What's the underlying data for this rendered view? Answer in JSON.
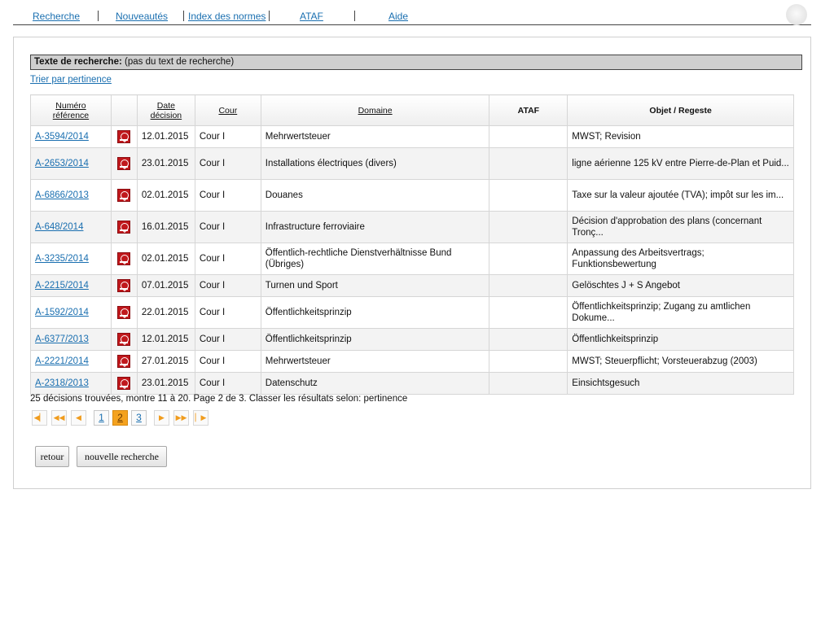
{
  "nav": {
    "items": [
      "Recherche",
      "Nouveautés",
      "Index des normes",
      "ATAF",
      "Aide"
    ]
  },
  "search": {
    "label": "Texte de recherche:",
    "value": "(pas du text de recherche)",
    "sort_link": "Trier par pertinence"
  },
  "table": {
    "headers": {
      "ref_line1": "Numéro",
      "ref_line2": "référence",
      "date_line1": "Date",
      "date_line2": "décision",
      "court": "Cour",
      "domain": "Domaine",
      "ataf": "ATAF",
      "subject": "Objet / Regeste"
    },
    "rows": [
      {
        "ref": "A-3594/2014",
        "date": "12.01.2015",
        "court": "Cour I",
        "domain": "Mehrwertsteuer",
        "ataf": "",
        "subject": "MWST; Revision"
      },
      {
        "ref": "A-2653/2014",
        "date": "23.01.2015",
        "court": "Cour I",
        "domain": "Installations électriques (divers)",
        "ataf": "",
        "subject": "ligne aérienne 125 kV entre Pierre-de-Plan et Puid..."
      },
      {
        "ref": "A-6866/2013",
        "date": "02.01.2015",
        "court": "Cour I",
        "domain": "Douanes",
        "ataf": "",
        "subject": "Taxe sur la valeur ajoutée (TVA); impôt sur les im..."
      },
      {
        "ref": "A-648/2014",
        "date": "16.01.2015",
        "court": "Cour I",
        "domain": "Infrastructure ferroviaire",
        "ataf": "",
        "subject": "Décision d'approbation des plans (concernant Tronç..."
      },
      {
        "ref": "A-3235/2014",
        "date": "02.01.2015",
        "court": "Cour I",
        "domain": "Öffentlich-rechtliche Dienstverhältnisse Bund (Übriges)",
        "ataf": "",
        "subject": "Anpassung des Arbeitsvertrags; Funktionsbewertung"
      },
      {
        "ref": "A-2215/2014",
        "date": "07.01.2015",
        "court": "Cour I",
        "domain": "Turnen und Sport",
        "ataf": "",
        "subject": "Gelöschtes J + S Angebot"
      },
      {
        "ref": "A-1592/2014",
        "date": "22.01.2015",
        "court": "Cour I",
        "domain": "Öffentlichkeitsprinzip",
        "ataf": "",
        "subject": "Öffentlichkeitsprinzip; Zugang zu amtlichen Dokume..."
      },
      {
        "ref": "A-6377/2013",
        "date": "12.01.2015",
        "court": "Cour I",
        "domain": "Öffentlichkeitsprinzip",
        "ataf": "",
        "subject": "Öffentlichkeitsprinzip"
      },
      {
        "ref": "A-2221/2014",
        "date": "27.01.2015",
        "court": "Cour I",
        "domain": "Mehrwertsteuer",
        "ataf": "",
        "subject": "MWST; Steuerpflicht; Vorsteuerabzug (2003)"
      },
      {
        "ref": "A-2318/2013",
        "date": "23.01.2015",
        "court": "Cour I",
        "domain": "Datenschutz",
        "ataf": "",
        "subject": "Einsichtsgesuch"
      }
    ]
  },
  "summary": "25 décisions trouvées, montre 11 à 20. Page 2 de 3. Classer les résultats selon: pertinence",
  "pagination": {
    "pages": [
      "1",
      "2",
      "3"
    ],
    "current": "2"
  },
  "buttons": {
    "back": "retour",
    "new_search": "nouvelle recherche"
  },
  "colors": {
    "link": "#1a6fb0",
    "pager_accent": "#f4a21f",
    "pdf_red": "#c0181c"
  }
}
